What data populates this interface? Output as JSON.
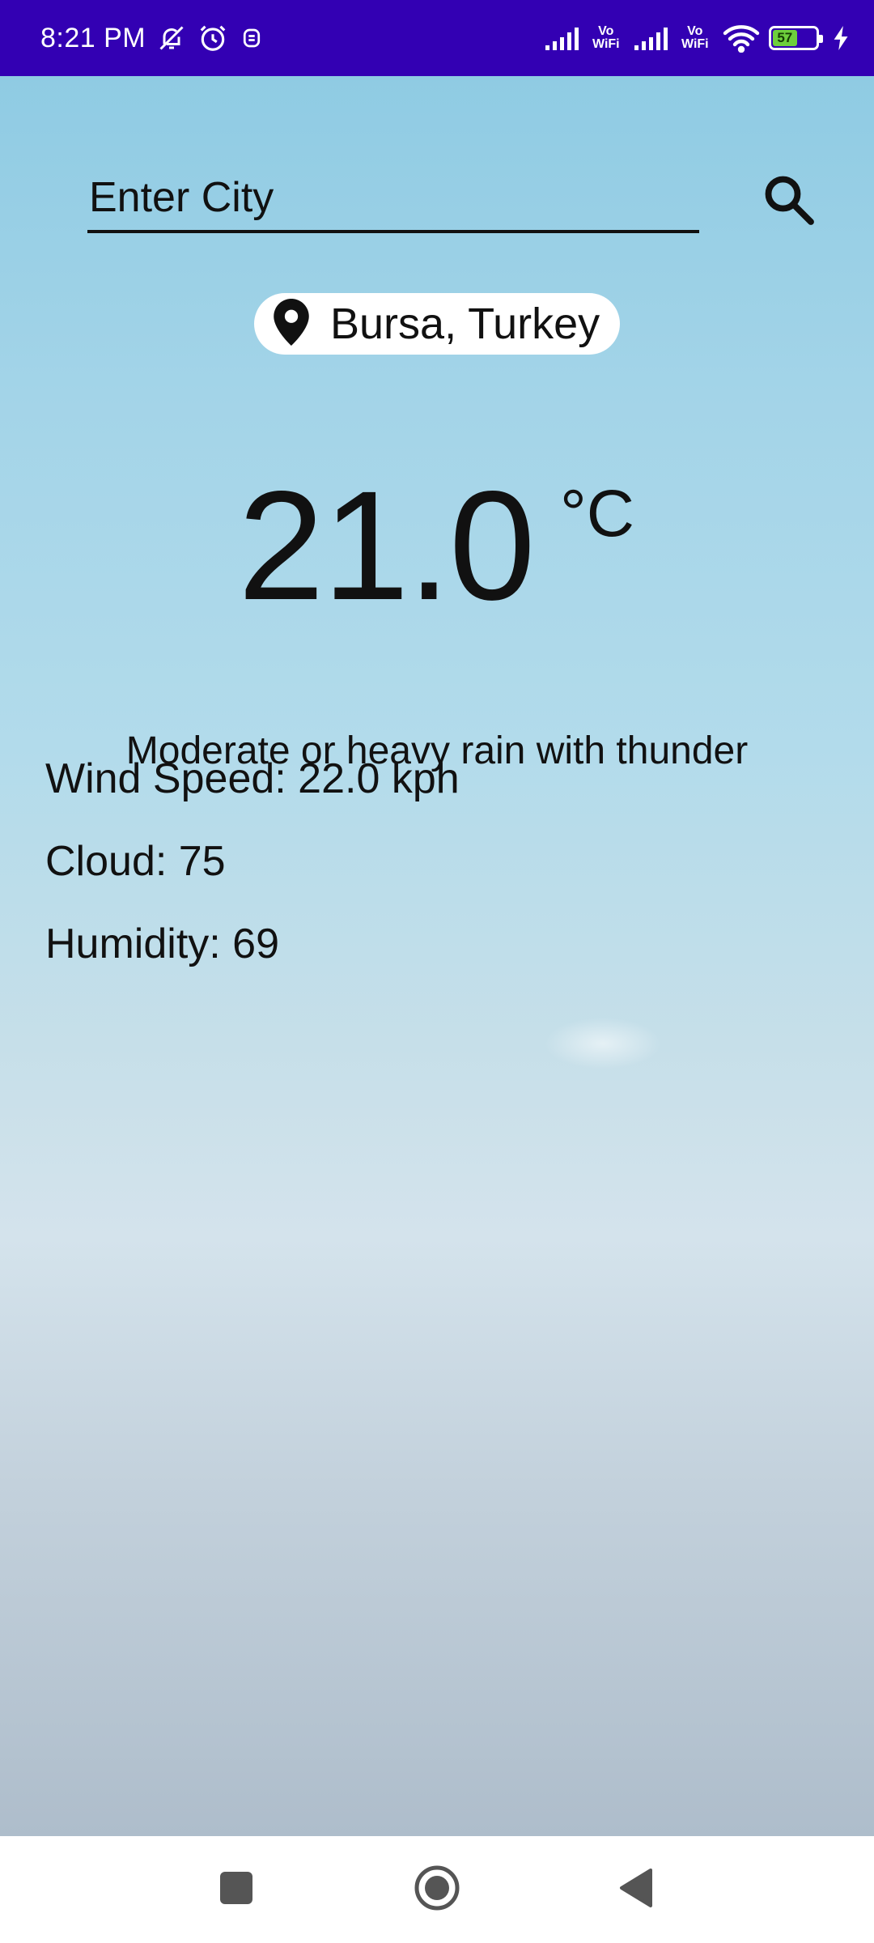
{
  "status_bar": {
    "time": "8:21 PM",
    "battery_level": "57",
    "vowifi_label_1": "Vo\nWiFi",
    "vowifi_label_2": "Vo\nWiFi",
    "icons": [
      "mute-bell-icon",
      "alarm-icon",
      "shield-icon",
      "signal-icon",
      "wifi-icon",
      "battery-icon",
      "charging-icon"
    ]
  },
  "search": {
    "placeholder": "Enter City",
    "value": ""
  },
  "location": {
    "label": "Bursa, Turkey"
  },
  "weather": {
    "temperature": "21.0",
    "unit": "°C",
    "condition": "Moderate or heavy rain with thunder",
    "wind_speed": "Wind Speed: 22.0 kph",
    "cloud": "Cloud: 75",
    "humidity": "Humidity: 69"
  },
  "colors": {
    "status_bar": "#3300b3",
    "battery_fill": "#6ecf3c"
  }
}
